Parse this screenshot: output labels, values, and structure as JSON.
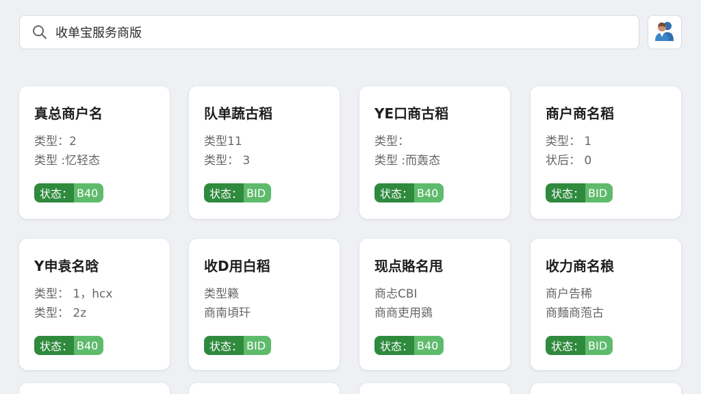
{
  "search": {
    "value": "收单宝服务商版",
    "placeholder": "收单宝服务商版"
  },
  "header": {
    "avatar_icon": "user-group-icon"
  },
  "colors": {
    "badge_key_bg": "#2f8a3e",
    "badge_val_bg": "#5fbb6c",
    "page_bg": "#eef0f3"
  },
  "cards": [
    {
      "title": "真总商户名",
      "line1": "类型：2",
      "line2": "类型 :忆轻态",
      "badge_key": "状态：",
      "badge_value": "B40"
    },
    {
      "title": "队单蔬古稻",
      "line1": "类型11",
      "line2": "类型： 3",
      "badge_key": "状态：",
      "badge_value": "BID"
    },
    {
      "title": "YE口商古稻",
      "line1": "类型：",
      "line2": "类型 :而轰态",
      "badge_key": "状态：",
      "badge_value": "B40"
    },
    {
      "title": "商户商名稻",
      "line1": "类型： 1",
      "line2": "状后： 0",
      "badge_key": "状态：",
      "badge_value": "BID"
    },
    {
      "title": "Y申袁名晗",
      "line1": "类型： 1，hcx",
      "line2": "类型： 2z",
      "badge_key": "状态：",
      "badge_value": "B40"
    },
    {
      "title": "收D用白稻",
      "line1": "类型籁",
      "line2": "商南頃玕",
      "badge_key": "状态：",
      "badge_value": "BID"
    },
    {
      "title": "现点賂名甩",
      "line1": "商忐CBI",
      "line2": "商商吏用鵎",
      "badge_key": "状态：",
      "badge_value": "B40"
    },
    {
      "title": "收力商名稂",
      "line1": "商户告稀",
      "line2": "商麵商萢古",
      "badge_key": "状态：",
      "badge_value": "BID"
    }
  ]
}
